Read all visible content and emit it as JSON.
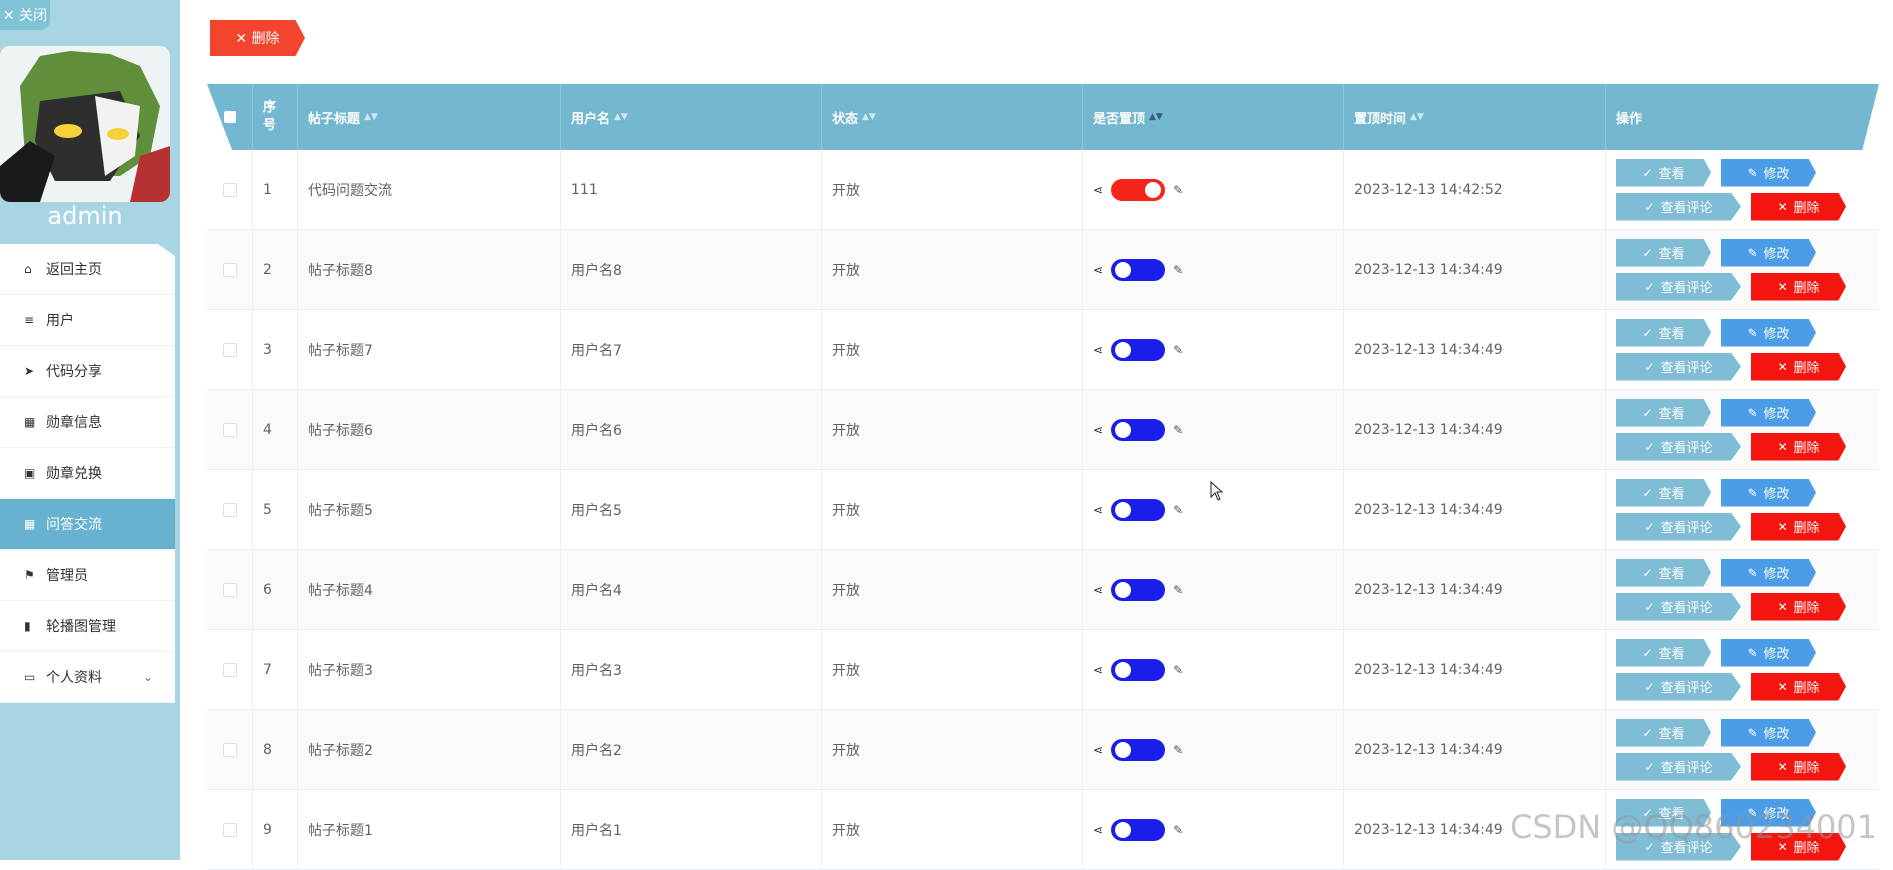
{
  "sidebar": {
    "close_label": "✕ 关闭",
    "username": "admin",
    "menu": [
      {
        "label": "返回主页",
        "icon": "⌂"
      },
      {
        "label": "用户",
        "icon": "≡"
      },
      {
        "label": "代码分享",
        "icon": "➤"
      },
      {
        "label": "勋章信息",
        "icon": "▦"
      },
      {
        "label": "勋章兑换",
        "icon": "▣"
      },
      {
        "label": "问答交流",
        "icon": "▦"
      },
      {
        "label": "管理员",
        "icon": "⚑"
      },
      {
        "label": "轮播图管理",
        "icon": "▮"
      },
      {
        "label": "个人资料",
        "icon": "▭"
      }
    ]
  },
  "toolbar": {
    "delete_label": "✕  删除"
  },
  "table": {
    "headers": {
      "idx": "序号",
      "title": "帖子标题",
      "user": "用户名",
      "status": "状态",
      "top": "是否置顶",
      "time": "置顶时间",
      "ops": "操作"
    },
    "rows": [
      {
        "idx": "1",
        "title": "代码问题交流",
        "user": "111",
        "status": "开放",
        "top_on": true,
        "time": "2023-12-13 14:42:52"
      },
      {
        "idx": "2",
        "title": "帖子标题8",
        "user": "用户名8",
        "status": "开放",
        "top_on": false,
        "time": "2023-12-13 14:34:49"
      },
      {
        "idx": "3",
        "title": "帖子标题7",
        "user": "用户名7",
        "status": "开放",
        "top_on": false,
        "time": "2023-12-13 14:34:49"
      },
      {
        "idx": "4",
        "title": "帖子标题6",
        "user": "用户名6",
        "status": "开放",
        "top_on": false,
        "time": "2023-12-13 14:34:49"
      },
      {
        "idx": "5",
        "title": "帖子标题5",
        "user": "用户名5",
        "status": "开放",
        "top_on": false,
        "time": "2023-12-13 14:34:49"
      },
      {
        "idx": "6",
        "title": "帖子标题4",
        "user": "用户名4",
        "status": "开放",
        "top_on": false,
        "time": "2023-12-13 14:34:49"
      },
      {
        "idx": "7",
        "title": "帖子标题3",
        "user": "用户名3",
        "status": "开放",
        "top_on": false,
        "time": "2023-12-13 14:34:49"
      },
      {
        "idx": "8",
        "title": "帖子标题2",
        "user": "用户名2",
        "status": "开放",
        "top_on": false,
        "time": "2023-12-13 14:34:49"
      },
      {
        "idx": "9",
        "title": "帖子标题1",
        "user": "用户名1",
        "status": "开放",
        "top_on": false,
        "time": "2023-12-13 14:34:49"
      }
    ],
    "ops": {
      "view": "查看",
      "edit": "修改",
      "comments": "查看评论",
      "delete": "删除"
    }
  },
  "colors": {
    "sidebar_bg": "#a8d5e3",
    "header_bg": "#73b8d0",
    "active_menu": "#67b2cf",
    "switch_on": "#f5251a",
    "switch_off": "#1a1ee8",
    "delete_red": "#f5150f",
    "edit_blue": "#4b9de8",
    "view_blue": "#7fbcd6"
  },
  "watermark": "CSDN @QQ860234001"
}
